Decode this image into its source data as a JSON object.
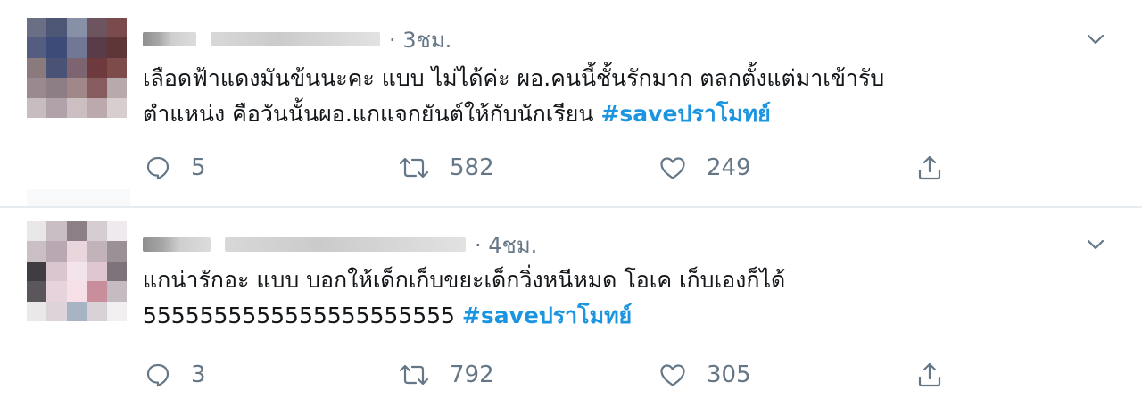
{
  "tweets": [
    {
      "time": "3ชม.",
      "text": "เลือดฟ้าแดงมันข้นนะคะ แบบ ไม่ได้ค่ะ ผอ.คนนี้ชั้นรักมาก ตลกตั้งแต่มาเข้ารับ\nตำแหน่ง คือวันนั้นผอ.แกแจกยันต์ให้กับนักเรียน ",
      "hashtag": "#saveปราโมทย์",
      "replies": "5",
      "retweets": "582",
      "likes": "249",
      "avatar_colors": [
        "#6b6f86",
        "#4e5676",
        "#8890a8",
        "#6d5560",
        "#7a4a4c",
        "#545d80",
        "#3d4b78",
        "#707895",
        "#5a3c48",
        "#5e3638",
        "#8a7a7e",
        "#4a5276",
        "#7c6470",
        "#6e3a3e",
        "#7d4b4a",
        "#9a8a90",
        "#8d7d85",
        "#a08888",
        "#865c5e",
        "#b7a9ac",
        "#c7bcc0",
        "#b0a2a8",
        "#cbbfc2",
        "#bca9ad",
        "#d8ced0"
      ]
    },
    {
      "time": "4ชม.",
      "text": "แกน่ารักอะ แบบ บอกให้เด็กเก็บขยะเด็กวิ่งหนีหมด โอเค เก็บเองก็ได้\n5555555555555555555555 ",
      "hashtag": "#saveปราโมทย์",
      "replies": "3",
      "retweets": "792",
      "likes": "305",
      "avatar_colors": [
        "#e9e6e8",
        "#c8bec4",
        "#8d7f86",
        "#d5cdd2",
        "#eeeaed",
        "#c9bfc4",
        "#b9a8b1",
        "#e8d6dc",
        "#c2b2b9",
        "#9b9096",
        "#3f3d42",
        "#d9c6cf",
        "#f2e4ea",
        "#e0c6d0",
        "#7c747a",
        "#5a565c",
        "#e6d3db",
        "#f6dfe7",
        "#c98e9c",
        "#c4bcc0",
        "#ebe8ea",
        "#dcd4d8",
        "#a8b4c4",
        "#d8d2d6",
        "#f1eff0"
      ]
    }
  ],
  "icons": {
    "caret": "chevron-down-icon",
    "reply": "reply-icon",
    "retweet": "retweet-icon",
    "like": "heart-icon",
    "share": "share-icon"
  },
  "colors": {
    "hashtag": "#1b95e0",
    "muted": "#657786",
    "text": "#14171a",
    "divider": "#e6ecf0"
  }
}
